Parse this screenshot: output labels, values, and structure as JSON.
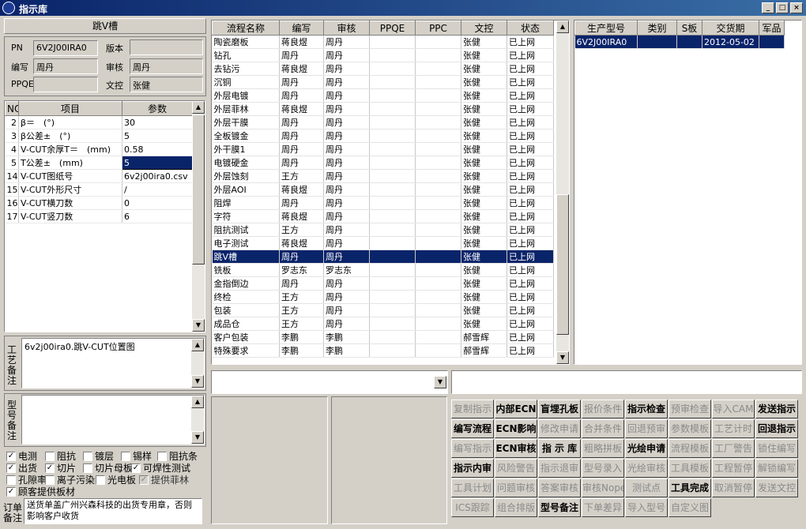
{
  "window": {
    "title": "指示库",
    "btn_min": "_",
    "btn_max": "□",
    "btn_close": "×"
  },
  "process_header": "跳V槽",
  "fields": {
    "pn_label": "PN",
    "pn_value": "6V2J00IRA0",
    "version_label": "版本",
    "version_value": "",
    "writer_label": "编写",
    "writer_value": "周丹",
    "reviewer_label": "审核",
    "reviewer_value": "周丹",
    "ppqe_label": "PPQE",
    "ppqe_value": "",
    "doc_label": "文控",
    "doc_value": "张健"
  },
  "params": {
    "headers": [
      "NO",
      "项目",
      "参数"
    ],
    "rows": [
      [
        "2",
        "β＝　(°)",
        "30"
      ],
      [
        "3",
        "β公差±　(°)",
        "5"
      ],
      [
        "4",
        "V-CUT余厚T＝　(mm)",
        "0.58"
      ],
      [
        "5",
        "T公差±　(mm)",
        "5"
      ],
      [
        "14",
        "V-CUT图纸号",
        "6v2j00ira0.csv"
      ],
      [
        "15",
        "V-CUT外形尺寸",
        "/"
      ],
      [
        "16",
        "V-CUT横刀数",
        "0"
      ],
      [
        "17",
        "V-CUT竖刀数",
        "6"
      ]
    ]
  },
  "process_note_label": "工艺备注",
  "process_note": "6v2j00ira0.跳V-CUT位置图",
  "model_note_label": "型号备注",
  "model_note": "",
  "checks": [
    {
      "label": "电测",
      "on": true,
      "dis": false
    },
    {
      "label": "阻抗",
      "on": false,
      "dis": false
    },
    {
      "label": "镀层",
      "on": false,
      "dis": false
    },
    {
      "label": "锡样",
      "on": false,
      "dis": false
    },
    {
      "label": "阻抗条",
      "on": false,
      "dis": false
    },
    {
      "label": "出货",
      "on": true,
      "dis": false
    },
    {
      "label": "切片",
      "on": true,
      "dis": false
    },
    {
      "label": "切片母板",
      "on": false,
      "dis": false
    },
    {
      "label": "可焊性测试",
      "on": true,
      "dis": false
    },
    {
      "label": "孔隙率",
      "on": false,
      "dis": false
    },
    {
      "label": "离子污染",
      "on": false,
      "dis": false
    },
    {
      "label": "光电板",
      "on": false,
      "dis": false
    },
    {
      "label": "提供菲林",
      "on": true,
      "dis": true
    },
    {
      "label": "顾客提供板材",
      "on": true,
      "dis": false
    }
  ],
  "order_note_label": "订单备注",
  "order_note": "送货单盖广州兴森科技的出货专用章，否则影响客户收货",
  "flow": {
    "headers": [
      "流程名称",
      "编写",
      "审核",
      "PPQE",
      "PPC",
      "文控",
      "状态"
    ],
    "rows": [
      [
        "陶瓷磨板",
        "蒋良煜",
        "周丹",
        "",
        "",
        "张健",
        "已上网"
      ],
      [
        "钻孔",
        "周丹",
        "周丹",
        "",
        "",
        "张健",
        "已上网"
      ],
      [
        "去钻污",
        "蒋良煜",
        "周丹",
        "",
        "",
        "张健",
        "已上网"
      ],
      [
        "沉铜",
        "周丹",
        "周丹",
        "",
        "",
        "张健",
        "已上网"
      ],
      [
        "外层电镀",
        "周丹",
        "周丹",
        "",
        "",
        "张健",
        "已上网"
      ],
      [
        "外层菲林",
        "蒋良煜",
        "周丹",
        "",
        "",
        "张健",
        "已上网"
      ],
      [
        "外层干膜",
        "周丹",
        "周丹",
        "",
        "",
        "张健",
        "已上网"
      ],
      [
        "全板镀金",
        "周丹",
        "周丹",
        "",
        "",
        "张健",
        "已上网"
      ],
      [
        "外干膜1",
        "周丹",
        "周丹",
        "",
        "",
        "张健",
        "已上网"
      ],
      [
        "电镀硬金",
        "周丹",
        "周丹",
        "",
        "",
        "张健",
        "已上网"
      ],
      [
        "外层蚀刻",
        "王方",
        "周丹",
        "",
        "",
        "张健",
        "已上网"
      ],
      [
        "外层AOI",
        "蒋良煜",
        "周丹",
        "",
        "",
        "张健",
        "已上网"
      ],
      [
        "阻焊",
        "周丹",
        "周丹",
        "",
        "",
        "张健",
        "已上网"
      ],
      [
        "字符",
        "蒋良煜",
        "周丹",
        "",
        "",
        "张健",
        "已上网"
      ],
      [
        "阻抗测试",
        "王方",
        "周丹",
        "",
        "",
        "张健",
        "已上网"
      ],
      [
        "电子测试",
        "蒋良煜",
        "周丹",
        "",
        "",
        "张健",
        "已上网"
      ],
      [
        "跳V槽",
        "周丹",
        "周丹",
        "",
        "",
        "张健",
        "已上网"
      ],
      [
        "铣板",
        "罗志东",
        "罗志东",
        "",
        "",
        "张健",
        "已上网"
      ],
      [
        "金指倒边",
        "周丹",
        "周丹",
        "",
        "",
        "张健",
        "已上网"
      ],
      [
        "终检",
        "王方",
        "周丹",
        "",
        "",
        "张健",
        "已上网"
      ],
      [
        "包装",
        "王方",
        "周丹",
        "",
        "",
        "张健",
        "已上网"
      ],
      [
        "成品仓",
        "王方",
        "周丹",
        "",
        "",
        "张健",
        "已上网"
      ],
      [
        "客户包装",
        "李鹏",
        "李鹏",
        "",
        "",
        "郝雪辉",
        "已上网"
      ],
      [
        "特殊要求",
        "李鹏",
        "李鹏",
        "",
        "",
        "郝雪辉",
        "已上网"
      ]
    ]
  },
  "orders": {
    "headers": [
      "生产型号",
      "类别",
      "S板",
      "交货期",
      "军品"
    ],
    "rows": [
      [
        "6V2J00IRA0",
        "",
        "",
        "2012-05-02",
        ""
      ]
    ]
  },
  "combo_value": "",
  "buttons": [
    {
      "label": "复制指示",
      "on": false
    },
    {
      "label": "内部ECN",
      "on": true
    },
    {
      "label": "盲埋孔板",
      "on": true
    },
    {
      "label": "报价条件",
      "on": false
    },
    {
      "label": "指示检查",
      "on": true
    },
    {
      "label": "预审检查",
      "on": false
    },
    {
      "label": "导入CAM",
      "on": false
    },
    {
      "label": "发送指示",
      "on": true
    },
    {
      "label": "编写流程",
      "on": true
    },
    {
      "label": "ECN影响",
      "on": true
    },
    {
      "label": "修改申请",
      "on": false
    },
    {
      "label": "合并条件",
      "on": false
    },
    {
      "label": "回退预审",
      "on": false
    },
    {
      "label": "参数模板",
      "on": false
    },
    {
      "label": "工艺计时",
      "on": false
    },
    {
      "label": "回退指示",
      "on": true
    },
    {
      "label": "编写指示",
      "on": false
    },
    {
      "label": "ECN审核",
      "on": true
    },
    {
      "label": "指 示 库",
      "on": true
    },
    {
      "label": "粗略拼板",
      "on": false
    },
    {
      "label": "光绘申请",
      "on": true
    },
    {
      "label": "流程模板",
      "on": false
    },
    {
      "label": "工厂警告",
      "on": false
    },
    {
      "label": "锁住编写",
      "on": false
    },
    {
      "label": "指示内审",
      "on": true
    },
    {
      "label": "风险警告",
      "on": false
    },
    {
      "label": "指示退审",
      "on": false
    },
    {
      "label": "型号录入",
      "on": false
    },
    {
      "label": "光绘审核",
      "on": false
    },
    {
      "label": "工具模板",
      "on": false
    },
    {
      "label": "工程暂停",
      "on": false
    },
    {
      "label": "解锁编写",
      "on": false
    },
    {
      "label": "工具计划",
      "on": false
    },
    {
      "label": "问题审核",
      "on": false
    },
    {
      "label": "答案审核",
      "on": false
    },
    {
      "label": "审核Nope",
      "on": false
    },
    {
      "label": "测试点",
      "on": false
    },
    {
      "label": "工具完成",
      "on": true
    },
    {
      "label": "取消暂停",
      "on": false
    },
    {
      "label": "发送文控",
      "on": false
    },
    {
      "label": "ICS跟踪",
      "on": false
    },
    {
      "label": "组合排版",
      "on": false
    },
    {
      "label": "型号备注",
      "on": true
    },
    {
      "label": "下单差异",
      "on": false
    },
    {
      "label": "导入型号",
      "on": false
    },
    {
      "label": "自定义图",
      "on": false
    }
  ]
}
